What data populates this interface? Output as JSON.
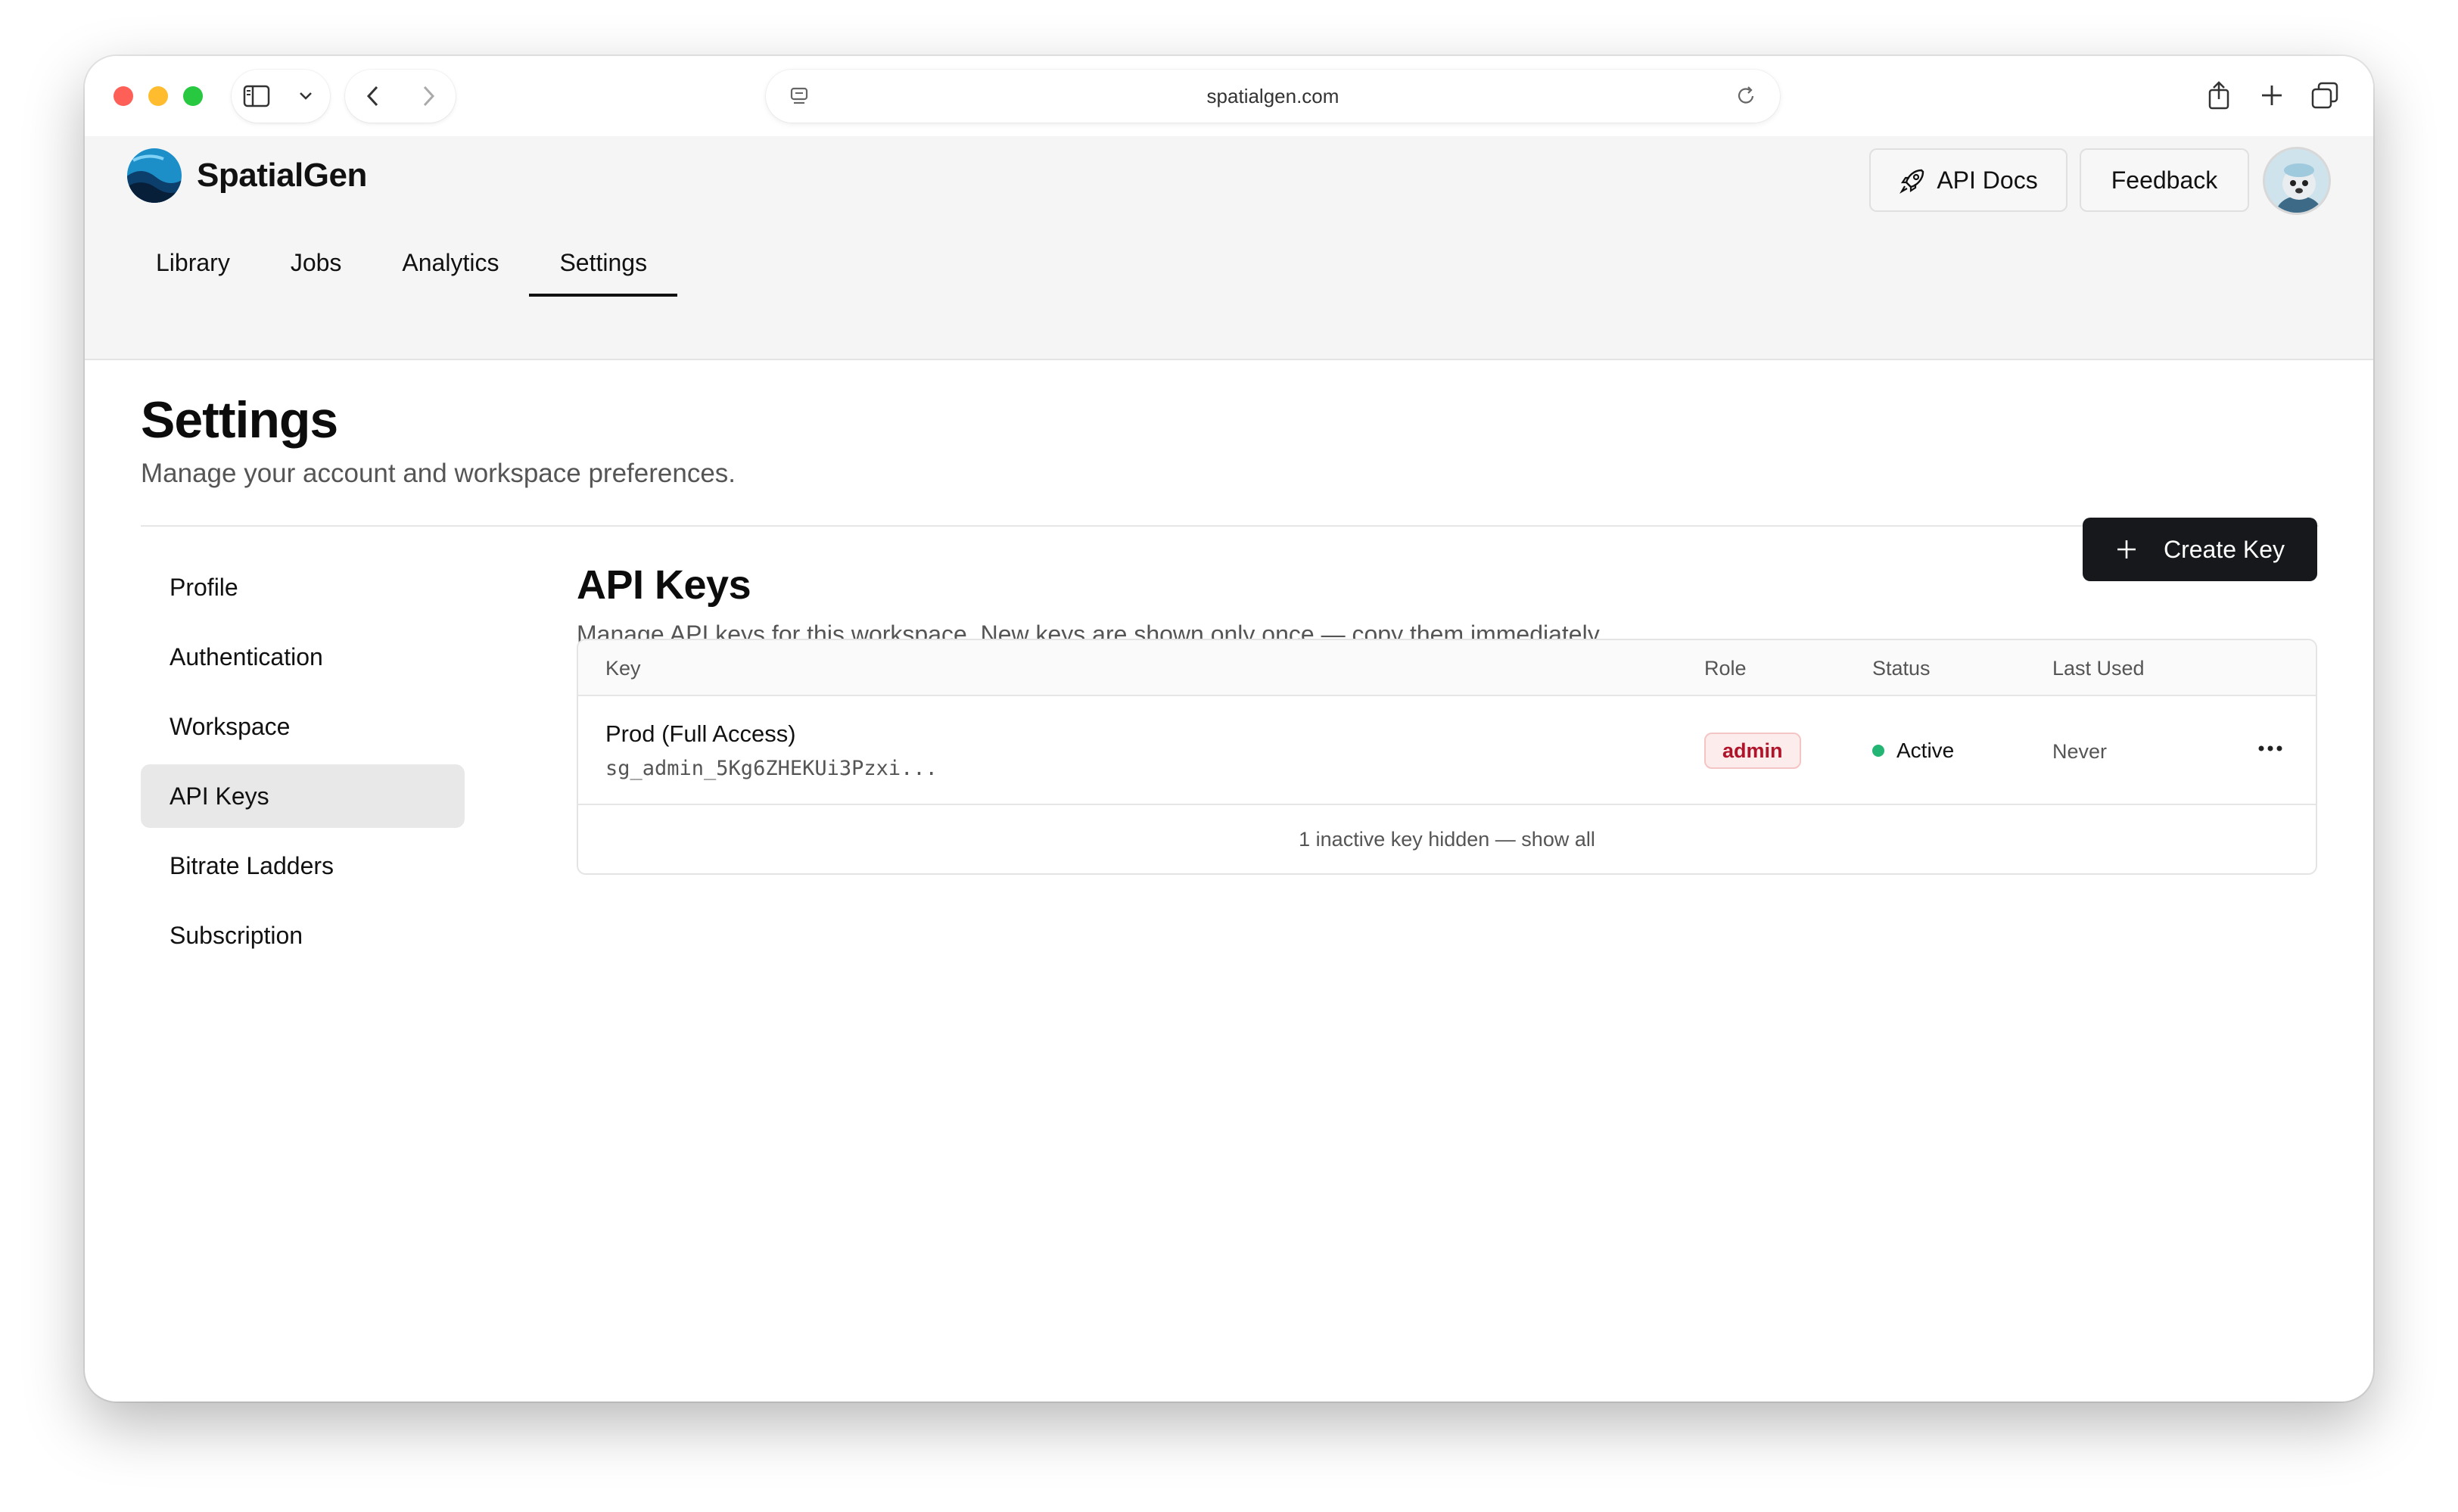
{
  "browser": {
    "url": "spatialgen.com"
  },
  "app": {
    "brand": "SpatialGen",
    "api_docs_label": "API Docs",
    "feedback_label": "Feedback",
    "nav": [
      "Library",
      "Jobs",
      "Analytics",
      "Settings"
    ],
    "active_nav": "Settings"
  },
  "page": {
    "title": "Settings",
    "subtitle": "Manage your account and workspace preferences."
  },
  "sidebar": {
    "items": [
      "Profile",
      "Authentication",
      "Workspace",
      "API Keys",
      "Bitrate Ladders",
      "Subscription"
    ],
    "active": "API Keys"
  },
  "api_keys": {
    "title": "API Keys",
    "subtitle": "Manage API keys for this workspace. New keys are shown only once — copy them immediately.",
    "create_label": "Create Key",
    "columns": {
      "key": "Key",
      "role": "Role",
      "status": "Status",
      "last_used": "Last Used"
    },
    "rows": [
      {
        "name": "Prod (Full Access)",
        "key": "sg_admin_5Kg6ZHEKUi3Pzxi...",
        "role": "admin",
        "status": "Active",
        "last_used": "Never"
      }
    ],
    "footer": "1 inactive key hidden — show all"
  },
  "colors": {
    "accent_dark": "#16181b",
    "status_active": "#22b573",
    "role_admin": "#b0142a"
  }
}
